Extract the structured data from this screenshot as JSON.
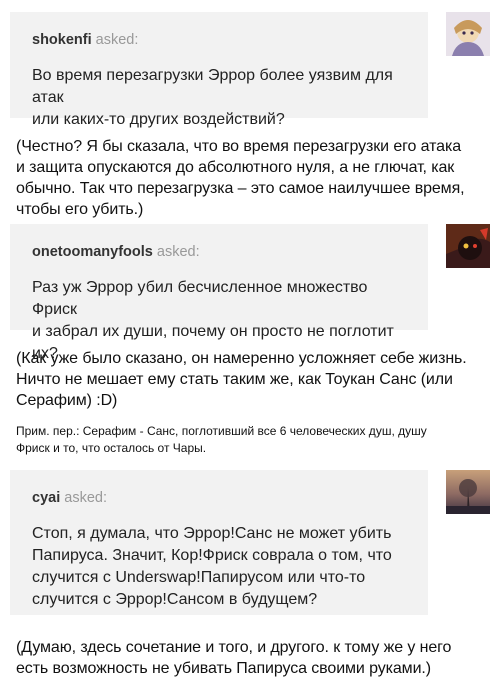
{
  "posts": [
    {
      "asker": "shokenfi",
      "verb": "asked:",
      "question_lines": [
        "Во время перезагрузки Эррор более уязвим для атак",
        "или каких-то других воздействий?"
      ],
      "answer_lines": [
        "(Честно? Я бы сказала, что во время перезагрузки его атака",
        "и защита опускаются до абсолютного нуля, а не глючат, как",
        "обычно. Так что перезагрузка – это самое наилучшее время,",
        "чтобы его убить.)"
      ]
    },
    {
      "asker": "onetoomanyfools",
      "verb": "asked:",
      "question_lines": [
        "Раз уж Эррор убил бесчисленное множество Фриск",
        "и забрал их души, почему он просто не поглотит их?"
      ],
      "answer_lines": [
        "(Как уже было сказано, он намеренно усложняет себе жизнь.",
        "Ничто не мешает ему стать таким же, как Тоукан Санс (или",
        "Серафим) :D)"
      ],
      "note_lines": [
        "Прим. пер.: Серафим - Санс, поглотивший все 6 человеческих душ, душу",
        "Фриск и то, что осталось от Чары."
      ]
    },
    {
      "asker": "cyai",
      "verb": "asked:",
      "question_lines": [
        "Стоп, я думала, что Эррор!Санс не может убить",
        "Папируса. Значит, Кор!Фриск соврала о том, что",
        "случится с Underswap!Папирусом или что-то",
        "случится с Эррор!Сансом в будущем?"
      ],
      "answer_lines": [
        "(Думаю, здесь сочетание и того, и другого. к тому же у него",
        "есть возможность не убивать Папируса своими руками.)"
      ]
    }
  ]
}
